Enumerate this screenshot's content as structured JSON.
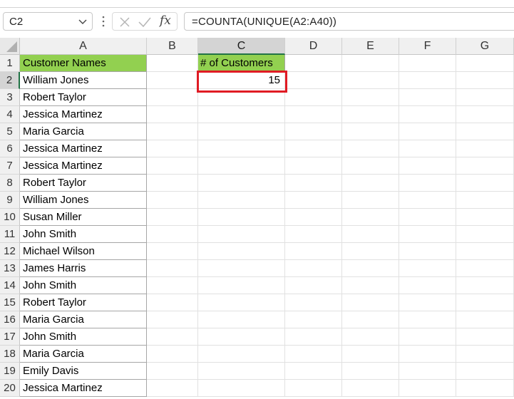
{
  "name_box": {
    "value": "C2"
  },
  "formula_bar": {
    "value": "=COUNTA(UNIQUE(A2:A40))",
    "fx_label": "fx"
  },
  "columns": [
    "A",
    "B",
    "C",
    "D",
    "E",
    "F",
    "G"
  ],
  "rows": [
    "1",
    "2",
    "3",
    "4",
    "5",
    "6",
    "7",
    "8",
    "9",
    "10",
    "11",
    "12",
    "13",
    "14",
    "15",
    "16",
    "17",
    "18",
    "19",
    "20"
  ],
  "column_a": {
    "header": "Customer Names",
    "names": [
      "William Jones",
      "Robert Taylor",
      "Jessica Martinez",
      "Maria Garcia",
      "Jessica Martinez",
      "Jessica Martinez",
      "Robert Taylor",
      "William Jones",
      "Susan Miller",
      "John Smith",
      "Michael Wilson",
      "James Harris",
      "John Smith",
      "Robert Taylor",
      "Maria Garcia",
      "John Smith",
      "Maria Garcia",
      "Emily Davis",
      "Jessica Martinez"
    ]
  },
  "column_c": {
    "header": "# of Customers",
    "result": "15"
  },
  "colors": {
    "header_fill": "#92d050",
    "selection_border": "#e01b24",
    "excel_green": "#217346"
  }
}
